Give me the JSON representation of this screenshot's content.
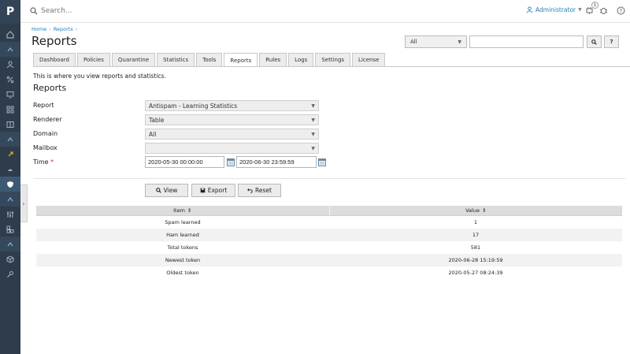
{
  "sidebar": {
    "logo": "P",
    "icons": [
      "dashboard-icon",
      "chevron-up-icon",
      "user-icon",
      "percent-icon",
      "monitor-icon",
      "grid-icon",
      "book-icon",
      "chevron-up-icon",
      "rocket-icon",
      "cloud-icon",
      "shield-icon",
      "chevron-up-icon",
      "sliders-icon",
      "apps-icon",
      "chevron-up-icon",
      "box-icon",
      "key-icon"
    ]
  },
  "topbar": {
    "search_placeholder": "Search...",
    "user": "Administrator",
    "notification_count": "1",
    "icons": [
      "plug-icon",
      "bug-icon",
      "help-icon"
    ]
  },
  "header": {
    "breadcrumb": [
      "Home",
      "Reports"
    ],
    "title": "Reports",
    "filter_select": "All",
    "filter_input": "",
    "search_btn": "⚲",
    "help_btn": "?"
  },
  "tabs": [
    {
      "label": "Dashboard",
      "active": false
    },
    {
      "label": "Policies",
      "active": false
    },
    {
      "label": "Quarantine",
      "active": false
    },
    {
      "label": "Statistics",
      "active": false
    },
    {
      "label": "Tools",
      "active": false
    },
    {
      "label": "Reports",
      "active": true
    },
    {
      "label": "Rules",
      "active": false
    },
    {
      "label": "Logs",
      "active": false
    },
    {
      "label": "Settings",
      "active": false
    },
    {
      "label": "License",
      "active": false
    }
  ],
  "content": {
    "intro": "This is where you view reports and statistics.",
    "section_title": "Reports"
  },
  "form": {
    "report_label": "Report",
    "report_value": "Antispam - Learning Statistics",
    "renderer_label": "Renderer",
    "renderer_value": "Table",
    "domain_label": "Domain",
    "domain_value": "All",
    "mailbox_label": "Mailbox",
    "mailbox_value": "",
    "time_label": "Time",
    "required_mark": "*",
    "time_from": "2020-05-30 00:00:00",
    "time_to": "2020-06-30 23:59:59"
  },
  "actions": {
    "view": "View",
    "export": "Export",
    "reset": "Reset"
  },
  "table": {
    "headers": [
      "Item",
      "Value"
    ],
    "rows": [
      [
        "Spam learned",
        "1"
      ],
      [
        "Ham learned",
        "17"
      ],
      [
        "Total tokens",
        "581"
      ],
      [
        "Newest token",
        "2020-06-28 15:19:59"
      ],
      [
        "Oldest token",
        "2020-05-27 08:24:39"
      ]
    ]
  }
}
